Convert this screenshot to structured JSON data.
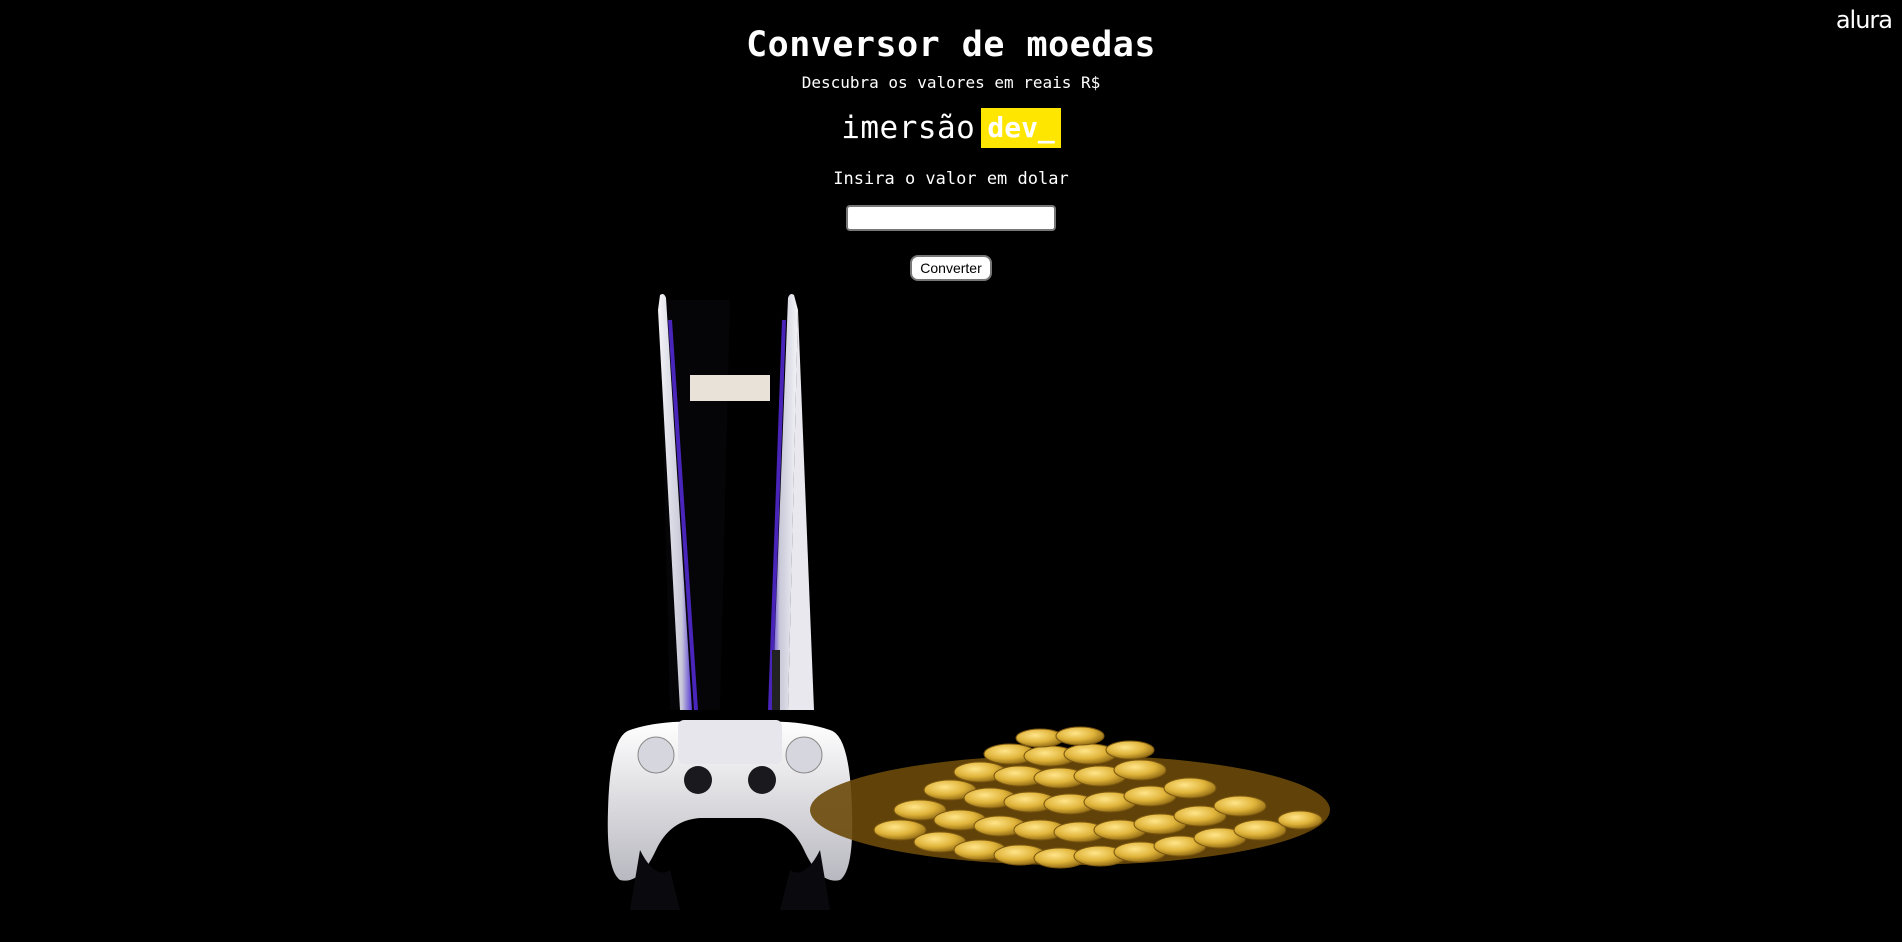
{
  "brand": {
    "logo_text": "alura"
  },
  "header": {
    "title": "Conversor de moedas",
    "subtitle": "Descubra os valores em reais R$"
  },
  "event_logo": {
    "word": "imersão",
    "tag": "dev_"
  },
  "form": {
    "label": "Insira o valor em dolar",
    "input_value": "",
    "input_placeholder": "",
    "button_label": "Converter"
  },
  "colors": {
    "background": "#000000",
    "accent": "#ffe600"
  },
  "image": {
    "description_icon": "ps5-console-and-gold-coins-illustration"
  }
}
